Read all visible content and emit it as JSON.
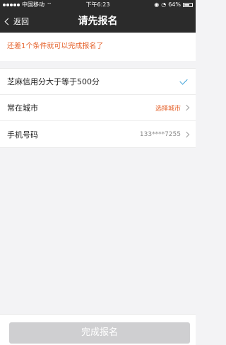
{
  "status_bar": {
    "carrier": "中国移动",
    "time": "下午6:23",
    "battery": "64%"
  },
  "nav": {
    "back_label": "返回",
    "title": "请先报名"
  },
  "notice": "还差1个条件就可以完成报名了",
  "rows": [
    {
      "label": "芝麻信用分大于等于500分",
      "value": "",
      "state": "checked"
    },
    {
      "label": "常在城市",
      "value": "选择城市",
      "value_color": "#e5612a"
    },
    {
      "label": "手机号码",
      "value": "133****7255",
      "value_color": "#8a8a8a"
    }
  ],
  "footer": {
    "submit_label": "完成报名"
  },
  "colors": {
    "accent": "#e5612a",
    "check": "#3aa0d8",
    "topbar": "#2b2b2b",
    "button_disabled": "#cfcfd1"
  }
}
